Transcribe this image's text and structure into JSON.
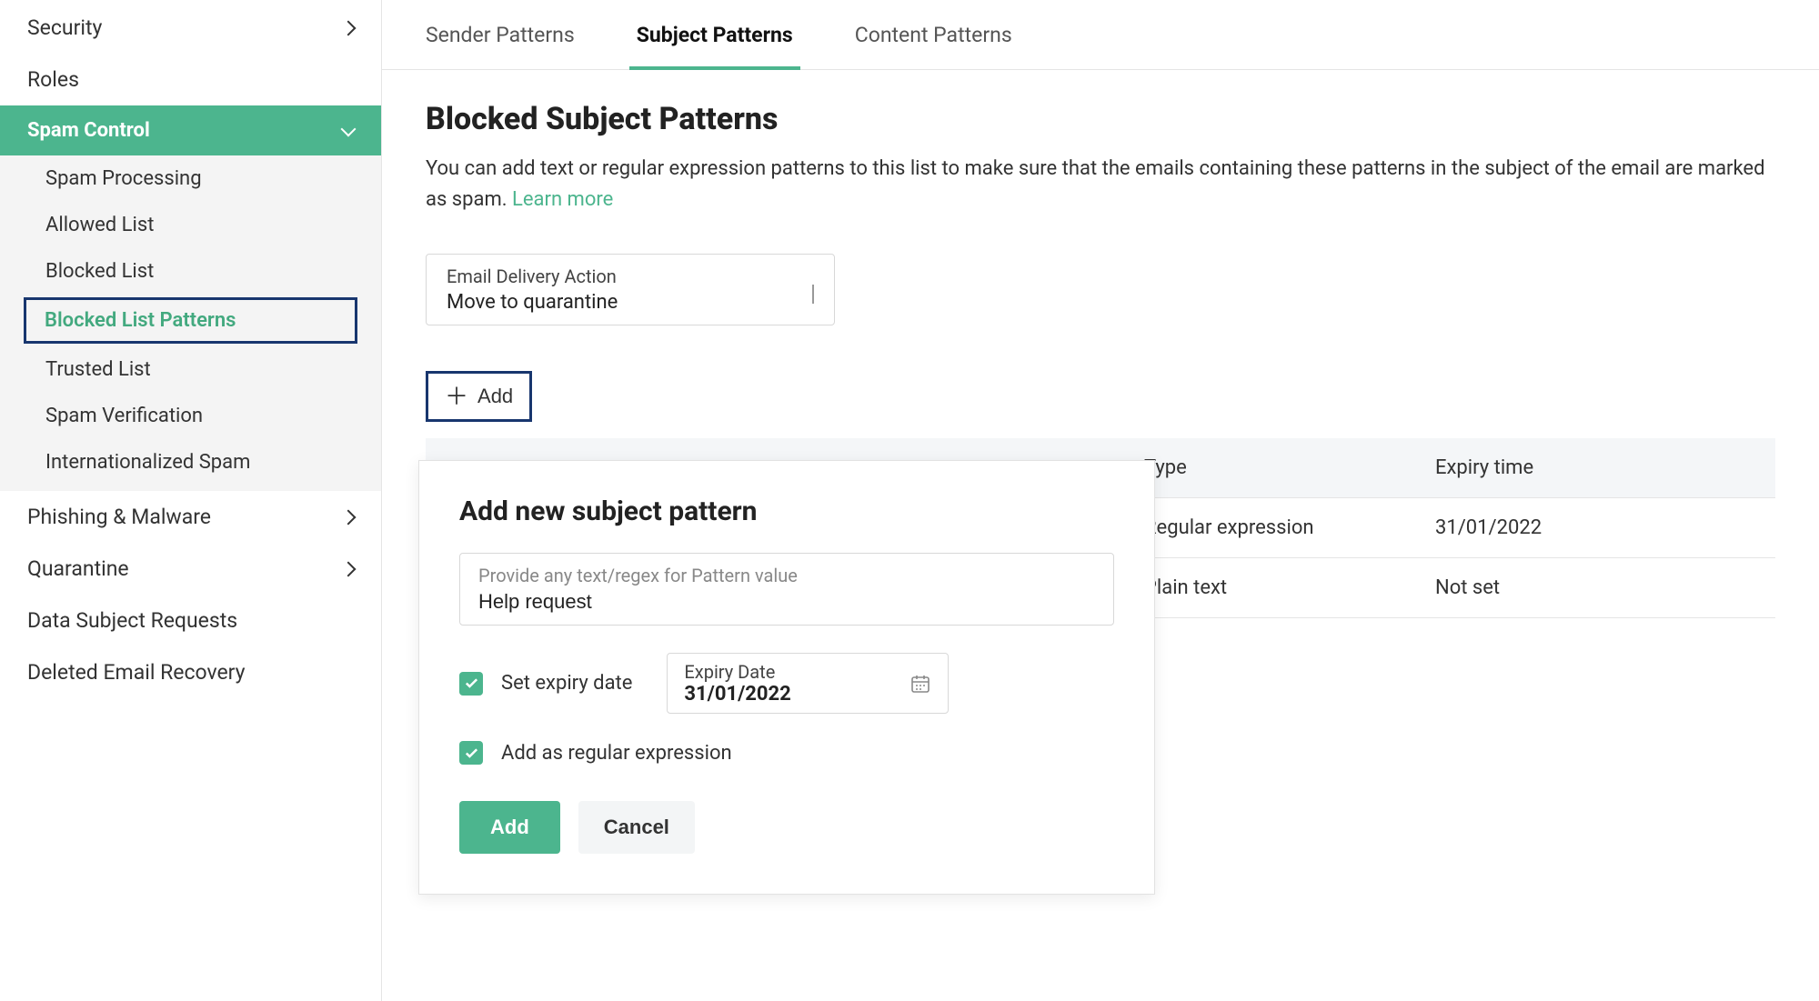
{
  "sidebar": {
    "top_items": [
      {
        "label": "Security",
        "has_chevron": true
      },
      {
        "label": "Roles",
        "has_chevron": false
      }
    ],
    "section": "Spam Control",
    "sub_items": [
      "Spam Processing",
      "Allowed List",
      "Blocked List",
      "Blocked List Patterns",
      "Trusted List",
      "Spam Verification",
      "Internationalized Spam"
    ],
    "bottom_items": [
      {
        "label": "Phishing & Malware",
        "has_chevron": true
      },
      {
        "label": "Quarantine",
        "has_chevron": true
      },
      {
        "label": "Data Subject Requests",
        "has_chevron": false
      },
      {
        "label": "Deleted Email Recovery",
        "has_chevron": false
      }
    ]
  },
  "tabs": [
    "Sender Patterns",
    "Subject Patterns",
    "Content Patterns"
  ],
  "active_tab": 1,
  "page_title": "Blocked Subject Patterns",
  "description_pre": "You can add text or regular expression patterns to this list to make sure that the emails containing these patterns in the subject of the email are marked as spam. ",
  "learn_more": "Learn more",
  "delivery_action": {
    "label": "Email Delivery Action",
    "value": "Move to quarantine"
  },
  "add_button": "Add",
  "table": {
    "headers": [
      "",
      "Type",
      "Expiry time"
    ],
    "rows": [
      {
        "type": "Regular expression",
        "expiry": "31/01/2022"
      },
      {
        "type": "Plain text",
        "expiry": "Not set"
      }
    ]
  },
  "popover": {
    "title": "Add new subject pattern",
    "pattern_label": "Provide any text/regex for Pattern value",
    "pattern_value": "Help request",
    "set_expiry_label": "Set expiry date",
    "expiry_date_label": "Expiry Date",
    "expiry_date_value": "31/01/2022",
    "add_regex_label": "Add as regular expression",
    "btn_add": "Add",
    "btn_cancel": "Cancel"
  }
}
